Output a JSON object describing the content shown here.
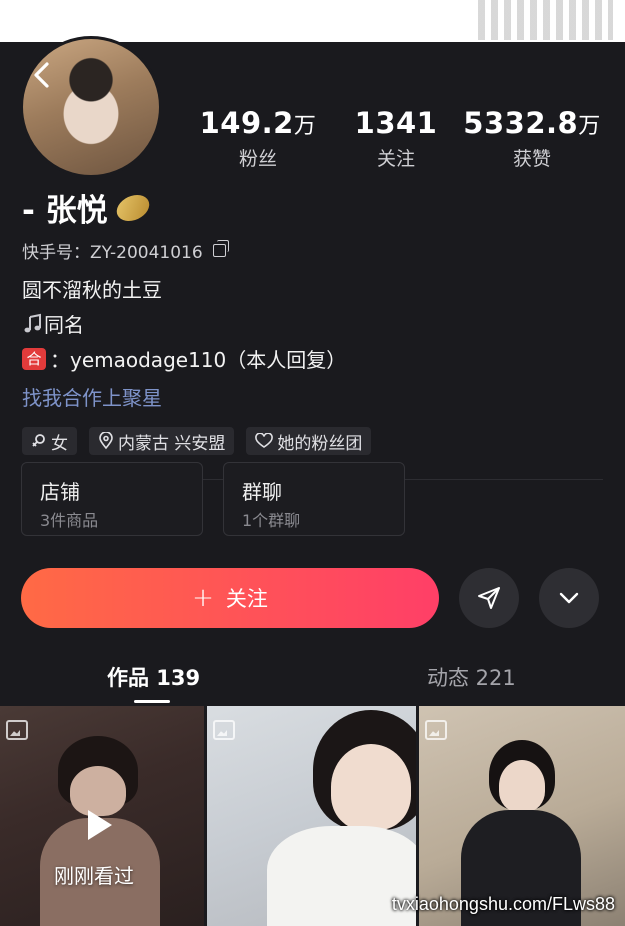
{
  "stats": [
    {
      "num": "149.2",
      "unit": "万",
      "label": "粉丝"
    },
    {
      "num": "1341",
      "unit": "",
      "label": "关注"
    },
    {
      "num": "5332.8",
      "unit": "万",
      "label": "获赞"
    }
  ],
  "profile": {
    "name": "- 张悦",
    "kuaishou_id": "快手号：ZY-20041016",
    "bio_line1": "圆不溜秋的土豆",
    "bio_line2_icon": "music-note-icon",
    "bio_line2": "同名",
    "bio_line3_badge": "合",
    "bio_line3": "：yemaodage110（本人回复）",
    "link": "找我合作上聚星"
  },
  "tags": [
    {
      "icon": "gender-icon",
      "label": "女"
    },
    {
      "icon": "location-icon",
      "label": "内蒙古 兴安盟"
    },
    {
      "icon": "heart-icon",
      "label": "她的粉丝团"
    }
  ],
  "cards": [
    {
      "title": "店铺",
      "subtitle": "3件商品"
    },
    {
      "title": "群聊",
      "subtitle": "1个群聊"
    }
  ],
  "actions": {
    "follow_label": "关注",
    "share_icon": "send-icon",
    "more_icon": "chevron-down-icon"
  },
  "tabs": [
    {
      "label": "作品 139"
    },
    {
      "label": "动态 221"
    }
  ],
  "grid": [
    {
      "label": "刚刚看过",
      "kind": "video"
    },
    {
      "label": "",
      "kind": "image"
    },
    {
      "label": "",
      "kind": "image"
    }
  ],
  "watermark": "tvxiaohongshu.com/FLws88",
  "colors": {
    "accent_start": "#ff6a45",
    "accent_end": "#ff3f67",
    "background": "#1a1a1e",
    "link": "#7e93c9"
  }
}
